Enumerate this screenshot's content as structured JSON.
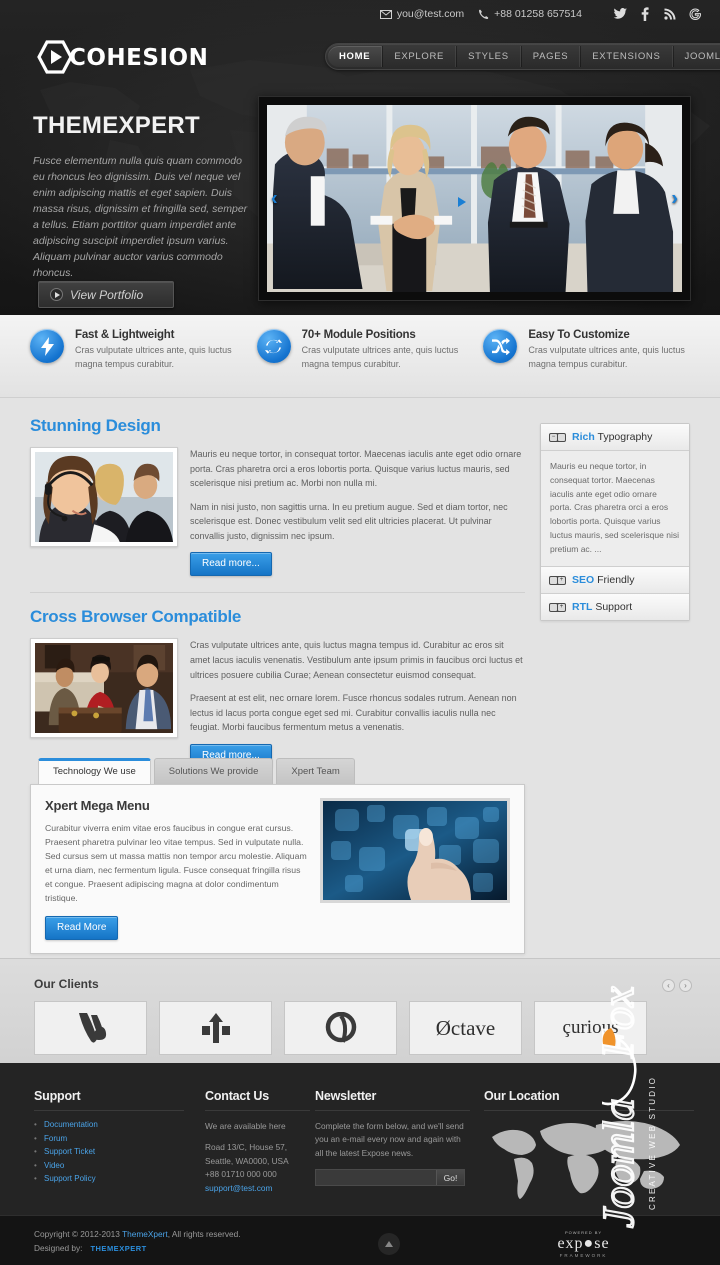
{
  "topbar": {
    "email": "you@test.com",
    "phone": "+88 01258 657514",
    "social": [
      {
        "name": "twitter-icon",
        "glyph": "🐦"
      },
      {
        "name": "facebook-icon",
        "glyph": "f"
      },
      {
        "name": "rss-icon",
        "glyph": "◖"
      },
      {
        "name": "google-plus-icon",
        "glyph": "G"
      }
    ]
  },
  "brand": {
    "name": "COHESION"
  },
  "nav": {
    "items": [
      {
        "label": "HOME",
        "active": true
      },
      {
        "label": "EXPLORE",
        "active": false
      },
      {
        "label": "STYLES",
        "active": false
      },
      {
        "label": "PAGES",
        "active": false
      },
      {
        "label": "EXTENSIONS",
        "active": false
      },
      {
        "label": "JOOMLA",
        "active": false
      }
    ]
  },
  "hero": {
    "title": "THEMEXPERT",
    "description": "Fusce elementum nulla quis quam commodo eu rhoncus leo dignissim. Duis vel neque vel enim adipiscing mattis et eget sapien. Duis massa risus, dignissim et fringilla sed, semper a tellus. Etiam porttitor quam imperdiet ante adipiscing suscipit imperdiet ipsum varius. Aliquam pulvinar auctor varius commodo rhoncus.",
    "button": "View Portfolio",
    "prev_arrow": "‹",
    "next_arrow": "›"
  },
  "features": [
    {
      "title": "Fast & Lightweight",
      "desc": "Cras vulputate ultrices ante, quis luctus magna tempus curabitur.",
      "icon": "lightning-bolt-icon"
    },
    {
      "title": "70+ Module Positions",
      "desc": "Cras vulputate ultrices ante, quis luctus magna tempus curabitur.",
      "icon": "refresh-cycle-icon"
    },
    {
      "title": "Easy To Customize",
      "desc": "Cras vulputate ultrices ante, quis luctus magna tempus curabitur.",
      "icon": "shuffle-icon"
    }
  ],
  "sections": [
    {
      "title": "Stunning Design",
      "p1": "Mauris eu neque tortor, in consequat tortor. Maecenas iaculis ante eget odio ornare porta. Cras pharetra orci a eros lobortis porta. Quisque varius luctus mauris, sed scelerisque nisi pretium ac. Morbi non nulla mi.",
      "p2": "Nam in nisi justo, non sagittis urna. In eu pretium augue. Sed et diam tortor, nec scelerisque est. Donec vestibulum velit sed elit ultricies placerat. Ut pulvinar convallis justo, dignissim nec ipsum.",
      "button": "Read more..."
    },
    {
      "title": "Cross Browser Compatible",
      "p1": "Cras vulputate ultrices ante, quis luctus magna tempus id. Curabitur ac eros sit amet lacus iaculis venenatis. Vestibulum ante ipsum primis in faucibus orci luctus et ultrices posuere cubilia Curae; Aenean consectetur euismod consequat.",
      "p2": "Praesent at est elit, nec ornare lorem. Fusce rhoncus sodales rutrum. Aenean non lectus id lacus porta congue eget sed mi. Curabitur convallis iaculis nulla nec feugiat. Morbi faucibus fermentum metus a venenatis.",
      "button": "Read more..."
    }
  ],
  "sidebar": {
    "accordion": [
      {
        "label_strong": "Rich",
        "label_rest": "Typography",
        "open": true,
        "body": "Mauris eu neque tortor, in consequat tortor. Maecenas iaculis ante eget odio ornare porta. Cras pharetra orci a eros lobortis porta. Quisque varius luctus mauris, sed scelerisque nisi pretium ac. ...",
        "toggle": "−"
      },
      {
        "label_strong": "SEO",
        "label_rest": "Friendly",
        "open": false,
        "body": "",
        "toggle": "+"
      },
      {
        "label_strong": "RTL",
        "label_rest": "Support",
        "open": false,
        "body": "",
        "toggle": "+"
      }
    ]
  },
  "tabs": {
    "items": [
      {
        "label": "Technology We use",
        "active": true
      },
      {
        "label": "Solutions We provide",
        "active": false
      },
      {
        "label": "Xpert Team",
        "active": false
      }
    ],
    "panel": {
      "title": "Xpert Mega Menu",
      "body": "Curabitur viverra enim vitae eros faucibus in congue erat cursus. Praesent pharetra pulvinar leo vitae tempus. Sed in vulputate nulla. Sed cursus sem ut massa mattis non tempor arcu molestie. Aliquam et urna diam, nec fermentum ligula. Fusce consequat fringilla risus et congue. Praesent adipiscing magna at dolor condimentum tristique.",
      "button": "Read More"
    }
  },
  "clients": {
    "title": "Our Clients",
    "prev": "‹",
    "next": "›",
    "logos": [
      {
        "name": "client-logo-ws",
        "text": "✒"
      },
      {
        "name": "client-logo-arrow",
        "text": "↑"
      },
      {
        "name": "client-logo-q",
        "text": "Ⓠ"
      },
      {
        "name": "client-logo-octave",
        "text": "Øctave"
      },
      {
        "name": "client-logo-curious",
        "text": "çurious"
      }
    ]
  },
  "footer": {
    "support": {
      "title": "Support",
      "links": [
        "Documentation",
        "Forum",
        "Support Ticket",
        "Video",
        "Support Policy"
      ]
    },
    "contact": {
      "title": "Contact Us",
      "intro": "We are available here",
      "address_line1": "Road 13/C, House 57,",
      "address_line2": "Seattle, WA0000, USA",
      "phone": "+88 01710 000 000",
      "email": "support@test.com"
    },
    "newsletter": {
      "title": "Newsletter",
      "desc": "Complete the form below, and we'll send you an e-mail every now and again with all the latest Expose news.",
      "input_value": "",
      "input_placeholder": "",
      "button": "Go!"
    },
    "location": {
      "title": "Our Location"
    }
  },
  "watermark": {
    "brand": "JoomlaFox",
    "tagline": "CREATIVE WEB STUDIO"
  },
  "copyright": {
    "prefix": "Copyright © 2012-2013 ",
    "link": "ThemeXpert",
    "suffix": ", All rights reserved.",
    "designed_by": "Designed by:",
    "designer": "THEMEXPERT",
    "framework_top": "POWERED BY",
    "framework_name": "exp●se",
    "framework_sub": "FRAMEWORK",
    "to_top": "scroll-to-top"
  },
  "colors": {
    "accent_blue": "#2b8ddb",
    "link_blue": "#4aa3e8",
    "dark_bg": "#242424",
    "page_bg": "#e3e3e3"
  }
}
